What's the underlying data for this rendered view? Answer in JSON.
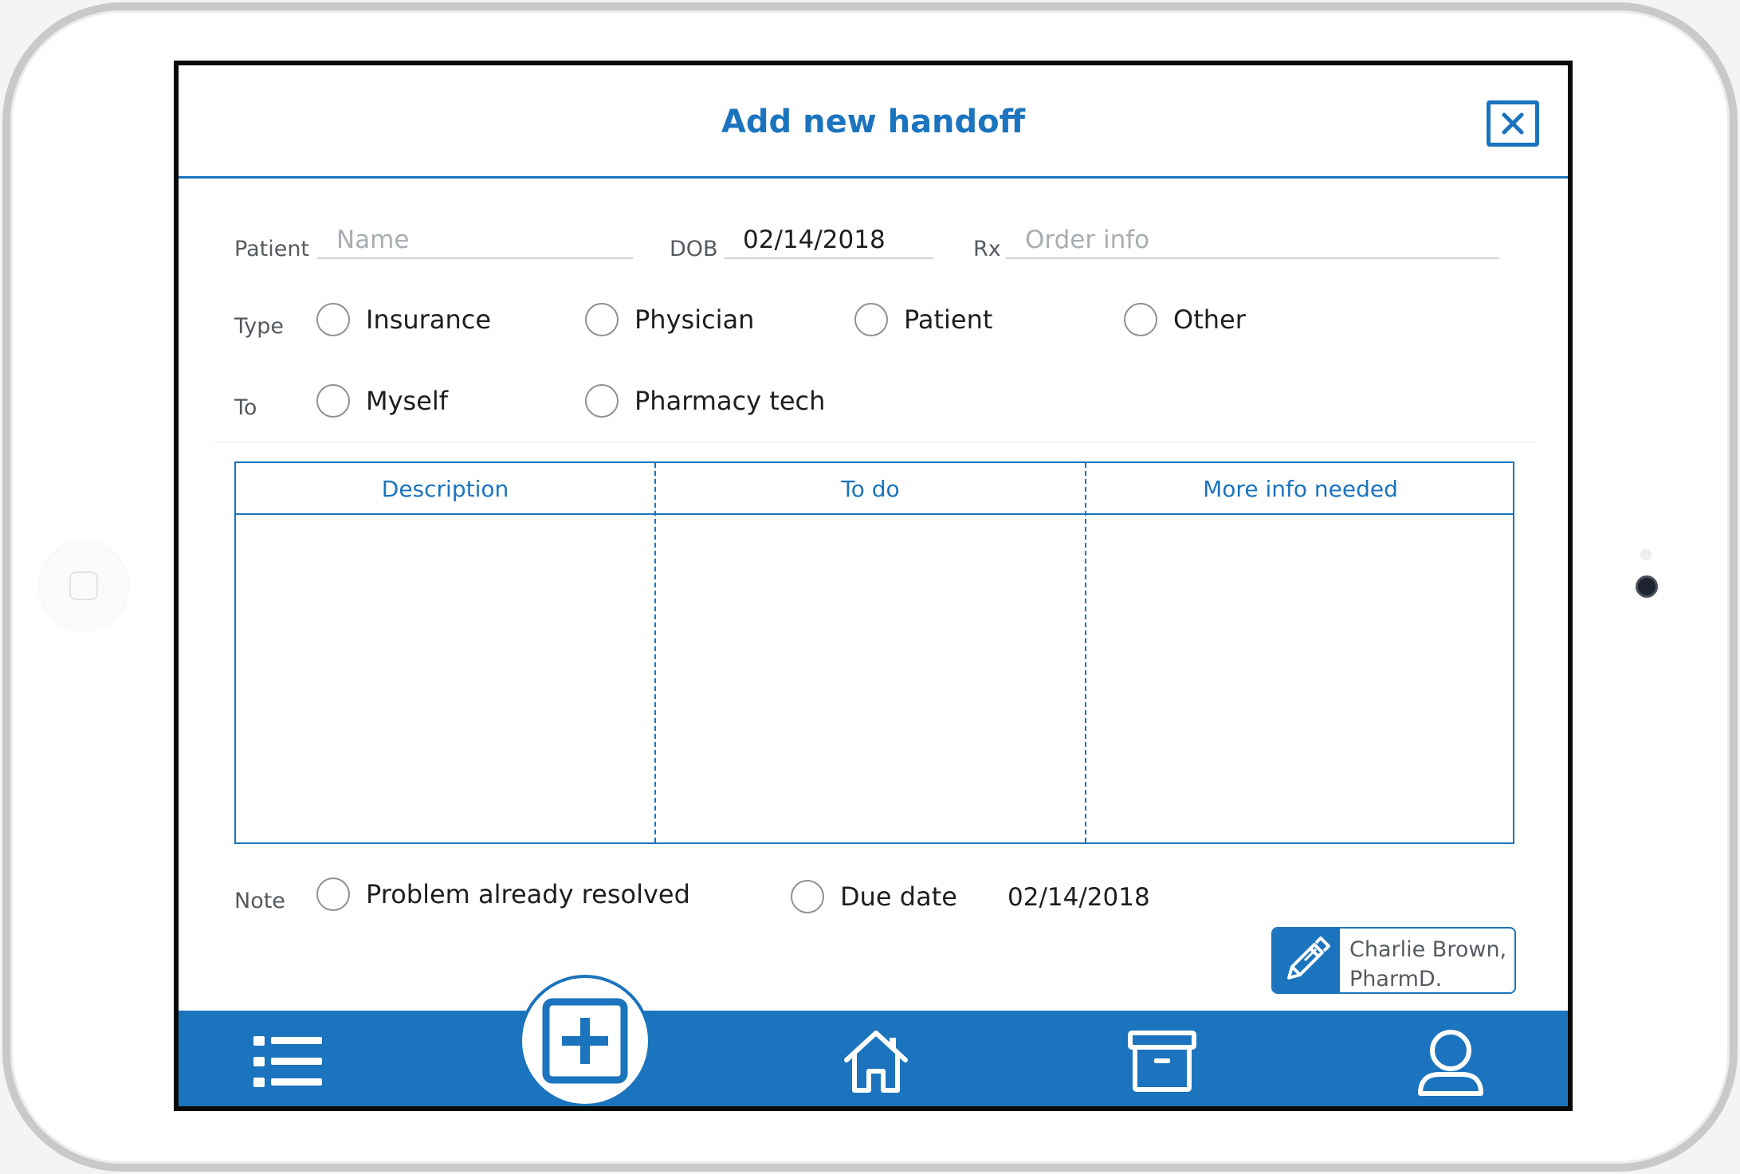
{
  "header": {
    "title": "Add new handoff"
  },
  "form": {
    "patient_label": "Patient",
    "patient_placeholder": "Name",
    "patient_value": "",
    "dob_label": "DOB",
    "dob_value": "02/14/2018",
    "rx_label": "Rx",
    "rx_placeholder": "Order info",
    "rx_value": "",
    "type_label": "Type",
    "type_options": [
      "Insurance",
      "Physician",
      "Patient",
      "Other"
    ],
    "to_label": "To",
    "to_options": [
      "Myself",
      "Pharmacy tech"
    ]
  },
  "grid": {
    "columns": [
      "Description",
      "To do",
      "More info needed"
    ]
  },
  "note": {
    "label": "Note",
    "resolved_label": "Problem already resolved",
    "due_label": "Due date",
    "due_value": "02/14/2018"
  },
  "signer": {
    "line1": "Charlie Brown,",
    "line2": "PharmD."
  },
  "nav": {
    "items": [
      "list-icon",
      "add-icon",
      "home-icon",
      "archive-icon",
      "profile-icon"
    ]
  },
  "colors": {
    "accent": "#1b74bd",
    "text": "#1e1e1e",
    "muted": "#555a60"
  }
}
